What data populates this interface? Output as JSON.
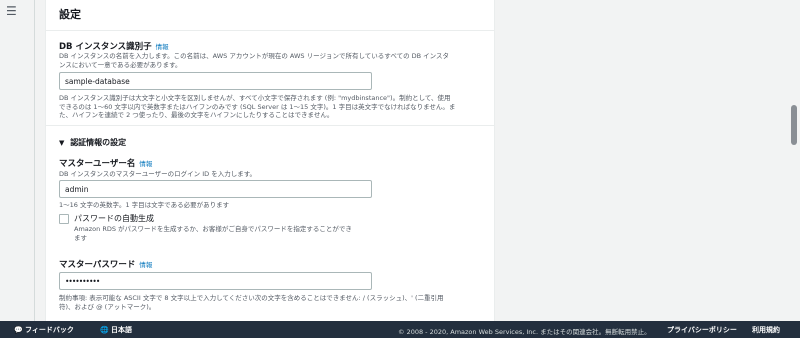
{
  "nav": {
    "menu_icon": "☰"
  },
  "section": {
    "title": "設定",
    "db_identifier": {
      "label": "DB インスタンス識別子",
      "info": "情報",
      "description_1": "DB インスタンスの名前を入力します。この名前は、AWS アカウントが現在の AWS リージョンで所有しているすべての DB インスタ",
      "description_2": "ンスにおいて一意である必要があります。",
      "value": "sample-database",
      "constraint_1": "DB インスタンス識別子は大文字と小文字を区別しませんが、すべて小文字で保存されます (例: \"mydbinstance\")。制約として、使用",
      "constraint_2": "できるのは 1〜60 文字以内で英数字またはハイフンのみです (SQL Server は 1〜15 文字)。1 字目は英文字でなければなりません。ま",
      "constraint_3": "た、ハイフンを連続で 2 つ使ったり、最後の文字をハイフンにしたりすることはできません。"
    },
    "credentials": {
      "heading": "認証情報の設定",
      "master_username": {
        "label": "マスターユーザー名",
        "info": "情報",
        "description": "DB インスタンスのマスターユーザーのログイン ID を入力します。",
        "value": "admin",
        "constraint": "1〜16 文字の英数字。1 字目は文字である必要があります"
      },
      "auto_generate": {
        "label": "パスワードの自動生成",
        "checked": false,
        "description_1": "Amazon RDS がパスワードを生成するか、お客様がご自身でパスワードを指定することができ",
        "description_2": "ます"
      },
      "master_password": {
        "label": "マスターパスワード",
        "info": "情報",
        "value": "••••••••••",
        "constraint_1": "制約事項: 表示可能な ASCII 文字で 8 文字以上で入力してください次の文字を含めることはできません: / (スラッシュ)、' (二重引用",
        "constraint_2": "符)、および @ (アットマーク)。"
      }
    }
  },
  "footer": {
    "feedback": "フィードバック",
    "language": "日本語",
    "copyright": "© 2008 - 2020, Amazon Web Services, Inc. またはその関連会社。無断転用禁止。",
    "privacy": "プライバシーポリシー",
    "terms": "利用規約"
  }
}
